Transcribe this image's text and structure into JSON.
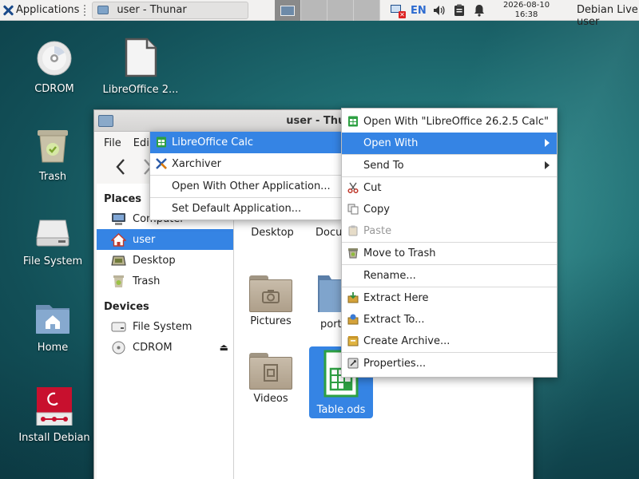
{
  "panel": {
    "applications_label": "Applications",
    "task_label": "user - Thunar",
    "lang": "EN",
    "clock_date": "2026-08-10",
    "clock_time": "16:38",
    "user_label": "Debian Live user"
  },
  "desktop": {
    "icons": [
      {
        "label": "CDROM",
        "icon": "cdrom-icon"
      },
      {
        "label": "LibreOffice 2...",
        "icon": "document-icon"
      },
      {
        "label": "Trash",
        "icon": "trash-icon"
      },
      {
        "label": "File System",
        "icon": "harddrive-icon"
      },
      {
        "label": "Home",
        "icon": "home-folder-icon"
      },
      {
        "label": "Install Debian",
        "icon": "debian-installer-icon"
      }
    ]
  },
  "window": {
    "title": "user - Thunar",
    "menus": [
      "File",
      "Edit"
    ],
    "sidebar": {
      "places_header": "Places",
      "places": [
        {
          "label": "Computer",
          "icon": "computer-icon"
        },
        {
          "label": "user",
          "icon": "home-icon",
          "selected": true
        },
        {
          "label": "Desktop",
          "icon": "desktop-icon"
        },
        {
          "label": "Trash",
          "icon": "trash-icon"
        }
      ],
      "devices_header": "Devices",
      "devices": [
        {
          "label": "File System",
          "icon": "harddrive-icon"
        },
        {
          "label": "CDROM",
          "icon": "cdrom-icon"
        }
      ]
    },
    "files": [
      {
        "label": "Desktop"
      },
      {
        "label": "Docum"
      },
      {
        "label": "Pictures"
      },
      {
        "label": "port"
      },
      {
        "label": "Videos"
      },
      {
        "label": "Table.ods",
        "selected": true
      }
    ]
  },
  "context_menu": {
    "items": [
      {
        "label": "Open With \"LibreOffice 26.2.5 Calc\"",
        "icon": "calc-icon"
      },
      {
        "label": "Open With",
        "highlighted": true,
        "submenu": true
      },
      {
        "label": "Send To",
        "submenu": true
      },
      {
        "label": "Cut",
        "icon": "scissors-icon"
      },
      {
        "label": "Copy",
        "icon": "copy-icon"
      },
      {
        "label": "Paste",
        "icon": "paste-icon",
        "disabled": true
      },
      {
        "label": "Move to Trash",
        "icon": "trash-icon"
      },
      {
        "label": "Rename..."
      },
      {
        "label": "Extract Here",
        "icon": "extract-icon"
      },
      {
        "label": "Extract To...",
        "icon": "extract-to-icon"
      },
      {
        "label": "Create Archive...",
        "icon": "archive-icon"
      },
      {
        "label": "Properties...",
        "icon": "properties-icon"
      }
    ]
  },
  "open_with_submenu": {
    "items": [
      {
        "label": "LibreOffice Calc",
        "icon": "calc-icon",
        "highlighted": true
      },
      {
        "label": "Xarchiver",
        "icon": "xarchiver-icon"
      },
      {
        "label": "Open With Other Application..."
      },
      {
        "label": "Set Default Application..."
      }
    ]
  },
  "colors": {
    "accent": "#3584e4",
    "panel_bg": "#f2f1f0",
    "desktop_bg": "#1f6d72"
  }
}
